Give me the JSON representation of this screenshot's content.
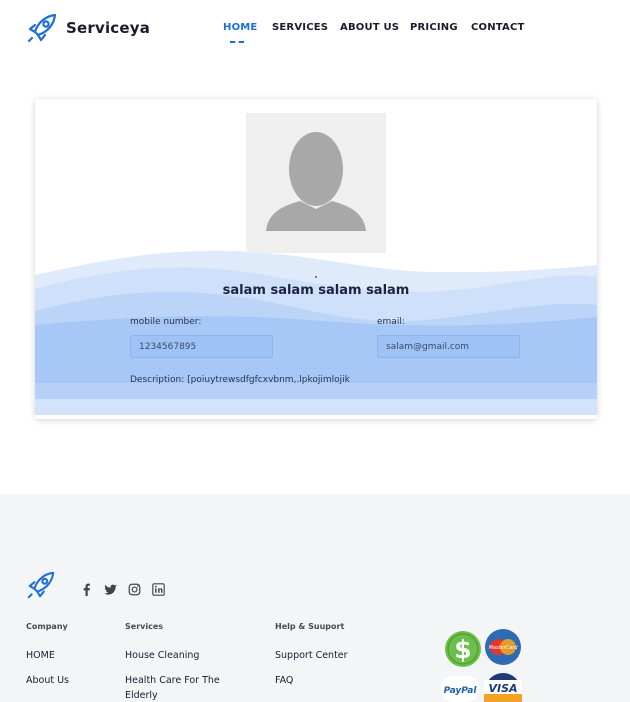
{
  "header": {
    "brand": "Serviceya",
    "nav": [
      {
        "label": "HOME",
        "active": true
      },
      {
        "label": "SERVICES",
        "active": false
      },
      {
        "label": "ABOUT US",
        "active": false
      },
      {
        "label": "PRICING",
        "active": false
      },
      {
        "label": "CONTACT",
        "active": false
      }
    ]
  },
  "profile": {
    "name": "salam salam salam salam",
    "mobile_label": "mobile number:",
    "mobile_value": "1234567895",
    "email_label": "email:",
    "email_value": "salam@gmail.com",
    "description": "Description: [poiuytrewsdfgfcxvbnm,.lpkojimlojik"
  },
  "footer": {
    "social": [
      "facebook-icon",
      "twitter-icon",
      "instagram-icon",
      "linkedin-icon"
    ],
    "company": {
      "heading": "Company",
      "links": [
        "HOME",
        "About Us"
      ]
    },
    "services": {
      "heading": "Services",
      "links": [
        "House Cleaning",
        "Health Care For The Elderly"
      ]
    },
    "help": {
      "heading": "Help & Suuport",
      "links": [
        "Support Center",
        "FAQ"
      ]
    },
    "payments": {
      "paypal": "PayPal",
      "visa": "VISA",
      "mastercard": "MasterCard",
      "dollar": "$"
    }
  },
  "colors": {
    "accent": "#1d6fd6",
    "wave": "#a7c7f7",
    "footer_bg": "#f4f5f7"
  }
}
